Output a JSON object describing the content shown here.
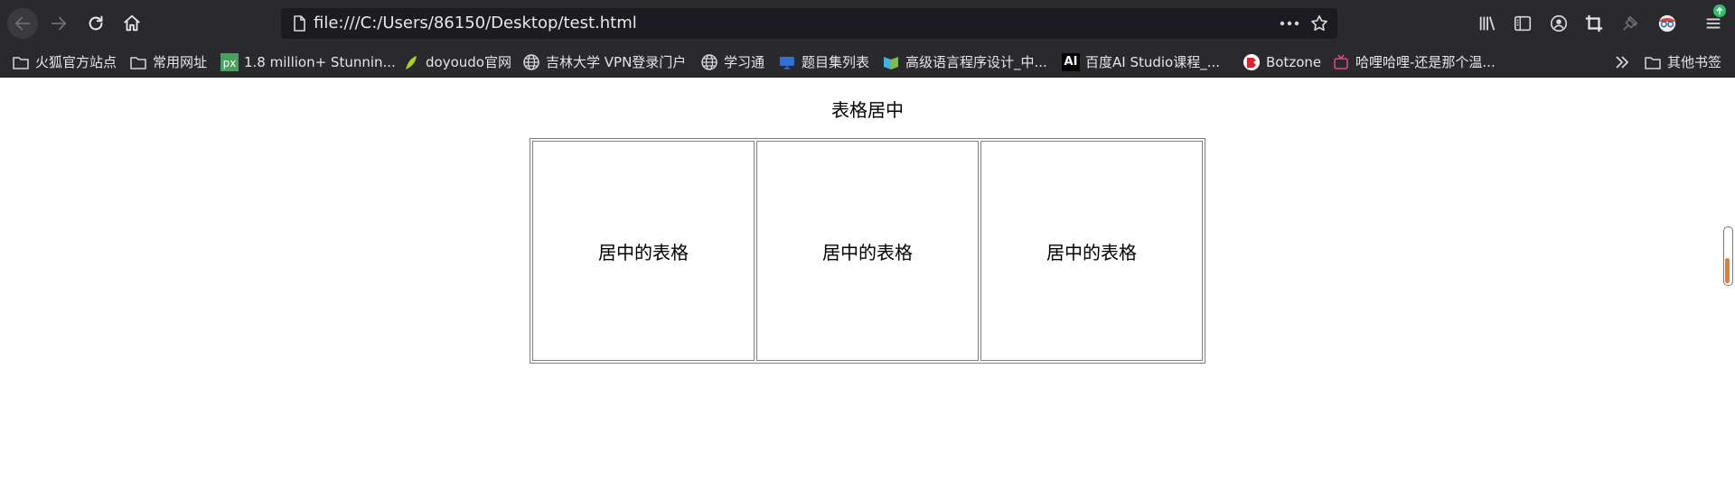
{
  "browser": {
    "url": "file:///C:/Users/86150/Desktop/test.html",
    "bookmarks": [
      {
        "label": "火狐官方站点",
        "icon": "folder-icon"
      },
      {
        "label": "常用网址",
        "icon": "folder-icon"
      },
      {
        "label": "1.8 million+ Stunnin...",
        "icon": "pixabay-icon"
      },
      {
        "label": "doyoudo官网",
        "icon": "leaf-icon"
      },
      {
        "label": "吉林大学 VPN登录门户",
        "icon": "globe-icon"
      },
      {
        "label": "学习通",
        "icon": "globe-icon"
      },
      {
        "label": "题目集列表",
        "icon": "monitor-icon"
      },
      {
        "label": "高级语言程序设计_中...",
        "icon": "book-icon"
      },
      {
        "label": "百度AI Studio课程_...",
        "icon": "ai-icon"
      },
      {
        "label": "Botzone",
        "icon": "botzone-icon"
      },
      {
        "label": "哈哩哈哩-还是那个温...",
        "icon": "tv-icon"
      }
    ],
    "other_bookmarks": "其他书签",
    "ai_badge": "AI"
  },
  "page": {
    "caption": "表格居中",
    "cells": [
      "居中的表格",
      "居中的表格",
      "居中的表格"
    ]
  },
  "colors": {
    "toolbar_bg": "#2a2a2e",
    "url_bg": "#1c1b22",
    "text_light": "#e6e6e8",
    "pixabay_green": "#48a25e",
    "scroll_accent": "#e57b2f"
  }
}
